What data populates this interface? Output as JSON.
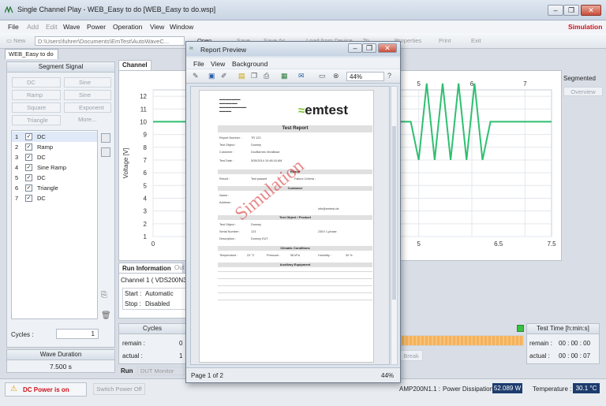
{
  "window": {
    "title": "Single Channel Play - WEB_Easy to do  [WEB_Easy to do.wsp]",
    "min": "–",
    "restore": "❐",
    "close": "✕"
  },
  "menu": [
    "File",
    "Add",
    "Edit",
    "Wave",
    "Power",
    "Operation",
    "View",
    "Window"
  ],
  "mode_label": "Simulation",
  "toolbar": {
    "new": "New",
    "path": "D:\\Users\\fuhrer\\Documents\\EmTest\\AutoWaveC...",
    "open": "Open",
    "save": "Save",
    "save_as": "Save As",
    "load": "Load from Device",
    "to_device": "To",
    "properties": "Properties",
    "print": "Print",
    "exit": "Exit"
  },
  "doc_tab": "WEB_Easy to do",
  "segment_signal": {
    "header": "Segment Signal",
    "buttons": [
      "DC",
      "Sine",
      "Ramp",
      "Sine Sweep",
      "Square",
      "Exponent",
      "Triangle",
      "More..."
    ],
    "segments": [
      {
        "n": "1",
        "label": "DC"
      },
      {
        "n": "2",
        "label": "Ramp"
      },
      {
        "n": "3",
        "label": "DC"
      },
      {
        "n": "4",
        "label": "Sine Ramp"
      },
      {
        "n": "5",
        "label": "DC"
      },
      {
        "n": "6",
        "label": "Triangle"
      },
      {
        "n": "7",
        "label": "DC"
      }
    ],
    "cycles_label": "Cycles :",
    "cycles_value": "1"
  },
  "wave_duration": {
    "label": "Wave Duration",
    "value": "7.500 s"
  },
  "channel_tab": "Channel",
  "segmented": {
    "label": "Segmented",
    "overview": "Overview"
  },
  "chart": {
    "ylabel": "Voltage [V]",
    "yticks": [
      "12",
      "11",
      "10",
      "9",
      "8",
      "7",
      "6",
      "5",
      "4",
      "3",
      "2",
      "1"
    ],
    "top_ticks": [
      "5",
      "6",
      "7"
    ],
    "bottom_ticks": [
      "0",
      "5",
      "6.5",
      "7.5"
    ]
  },
  "chart_data": {
    "type": "line",
    "x": [
      0,
      4.85,
      5.0,
      5.15,
      5.3,
      5.45,
      5.6,
      5.75,
      5.9,
      6.05,
      6.2,
      6.35,
      7.5
    ],
    "values": [
      10,
      10,
      7,
      13,
      7,
      13,
      7,
      13,
      7,
      13,
      7,
      10,
      10
    ],
    "ylabel": "Voltage [V]",
    "xlim": [
      0,
      7.5
    ],
    "ylim": [
      1,
      12.5
    ],
    "line_color": "#2fbf71",
    "grid": true
  },
  "run_info": {
    "tab": "Run Information",
    "tab2": "Out",
    "channel": "Channel 1 ( VDS200N30 on",
    "start_label": "Start :",
    "start_value": "Automatic",
    "stop_label": "Stop :",
    "stop_value": "Disabled"
  },
  "cycles_panel": {
    "header": "Cycles",
    "remain_label": "remain :",
    "remain_value": "0",
    "actual_label": "actual :",
    "actual_value": "1"
  },
  "run_tabs": {
    "run": "Run",
    "dut": "DUT Monitor"
  },
  "test_time": {
    "header": "Test Time [h:min:s]",
    "remain_label": "remain :",
    "remain_value": "00 : 00 : 00",
    "actual_label": "actual :",
    "actual_value": "00 : 00 : 07"
  },
  "progress": {
    "fraction": 1.0,
    "break_label": "Break"
  },
  "status": {
    "dc_power": "DC Power is on",
    "switch": "Switch Power Off",
    "device": "AMP200N1.1 :",
    "power_label": "Power Dissipation :",
    "power_value": "52.089 W",
    "temp_label": "Temperature :",
    "temp_value": "30.1 °C"
  },
  "report": {
    "title": "Report Preview",
    "menu": [
      "File",
      "View",
      "Background"
    ],
    "zoom": "44%",
    "page": "Page 1 of 2",
    "zoom_status": "44%",
    "doc": {
      "logo": "emtest",
      "heading": "Test Report",
      "watermark": "Simulation",
      "sections": [
        "Result",
        "Customer",
        "Test Object / Product",
        "Climatic Conditions",
        "Auxiliary Equipment"
      ],
      "fields": [
        "Report Number :",
        "Test Object :",
        "Customer :",
        "Test Date :",
        "Result :",
        "Name :",
        "Address :",
        "Serial Number :",
        "Description :",
        "Temperature :",
        "Pressure :",
        "Humidity :"
      ],
      "values": [
        "TR 123",
        "Dummy",
        "DocBarnes XbraBase",
        "5/28/2014 10:48:18 AM",
        "Test passed",
        "Failure Criteria :",
        "info@emtest.de",
        "123",
        "230V 1-phase",
        "Dummy EUT",
        "23 °C",
        "98 kPa",
        "30 %"
      ]
    }
  }
}
